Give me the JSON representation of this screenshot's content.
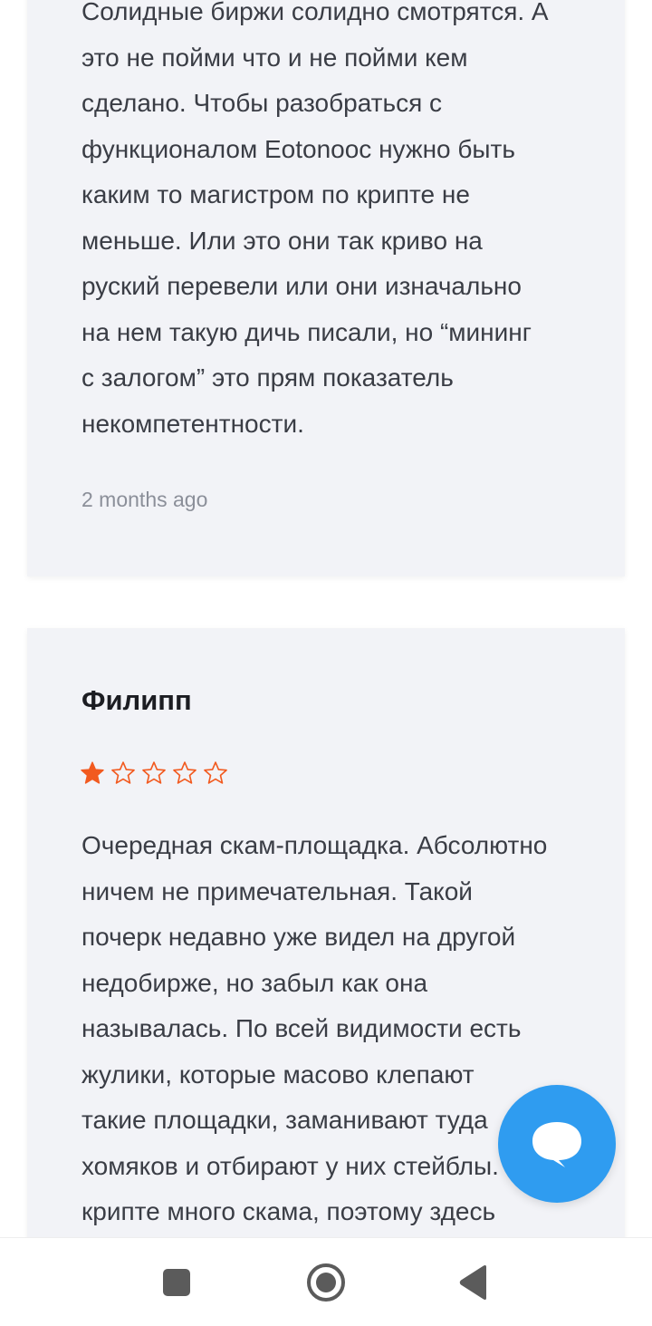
{
  "reviews": [
    {
      "text": "Солидные биржи солидно смотрятся. А\nэто не пойми что и не пойми кем\nсделано. Чтобы разобраться с\nфункционалом Eotonooc нужно быть\nкаким то магистром по крипте не\nменьше. Или это они так криво на\nруский перевели или они изначально\nна нем такую дичь писали, но “мининг\nс залогом” это прям показатель\nнекомпетентности.",
      "time": "2 months ago"
    },
    {
      "author": "Филипп",
      "rating": 1,
      "rating_max": 5,
      "text": "Очередная скам-площадка. Абсолютно\nничем не примечательная. Такой\nпочерк недавно уже видел на другой\nнедобирже, но забыл как она\nназывалась. По всей видимости есть\nжулики, которые масово клепают\nтакие площадки, заманивают туда\nхомяков и отбирают у них стейблы. В\nкрипте много скама, поэтому здесь"
    }
  ],
  "colors": {
    "card_bg": "#f2f3f7",
    "star_filled": "#f25a1f",
    "fab": "#2f9cf0",
    "nav_icon": "#5b5b5b"
  },
  "icons": {
    "fab": "chat-bubble-icon",
    "nav_recents": "square-icon",
    "nav_home": "circle-icon",
    "nav_back": "triangle-back-icon"
  }
}
